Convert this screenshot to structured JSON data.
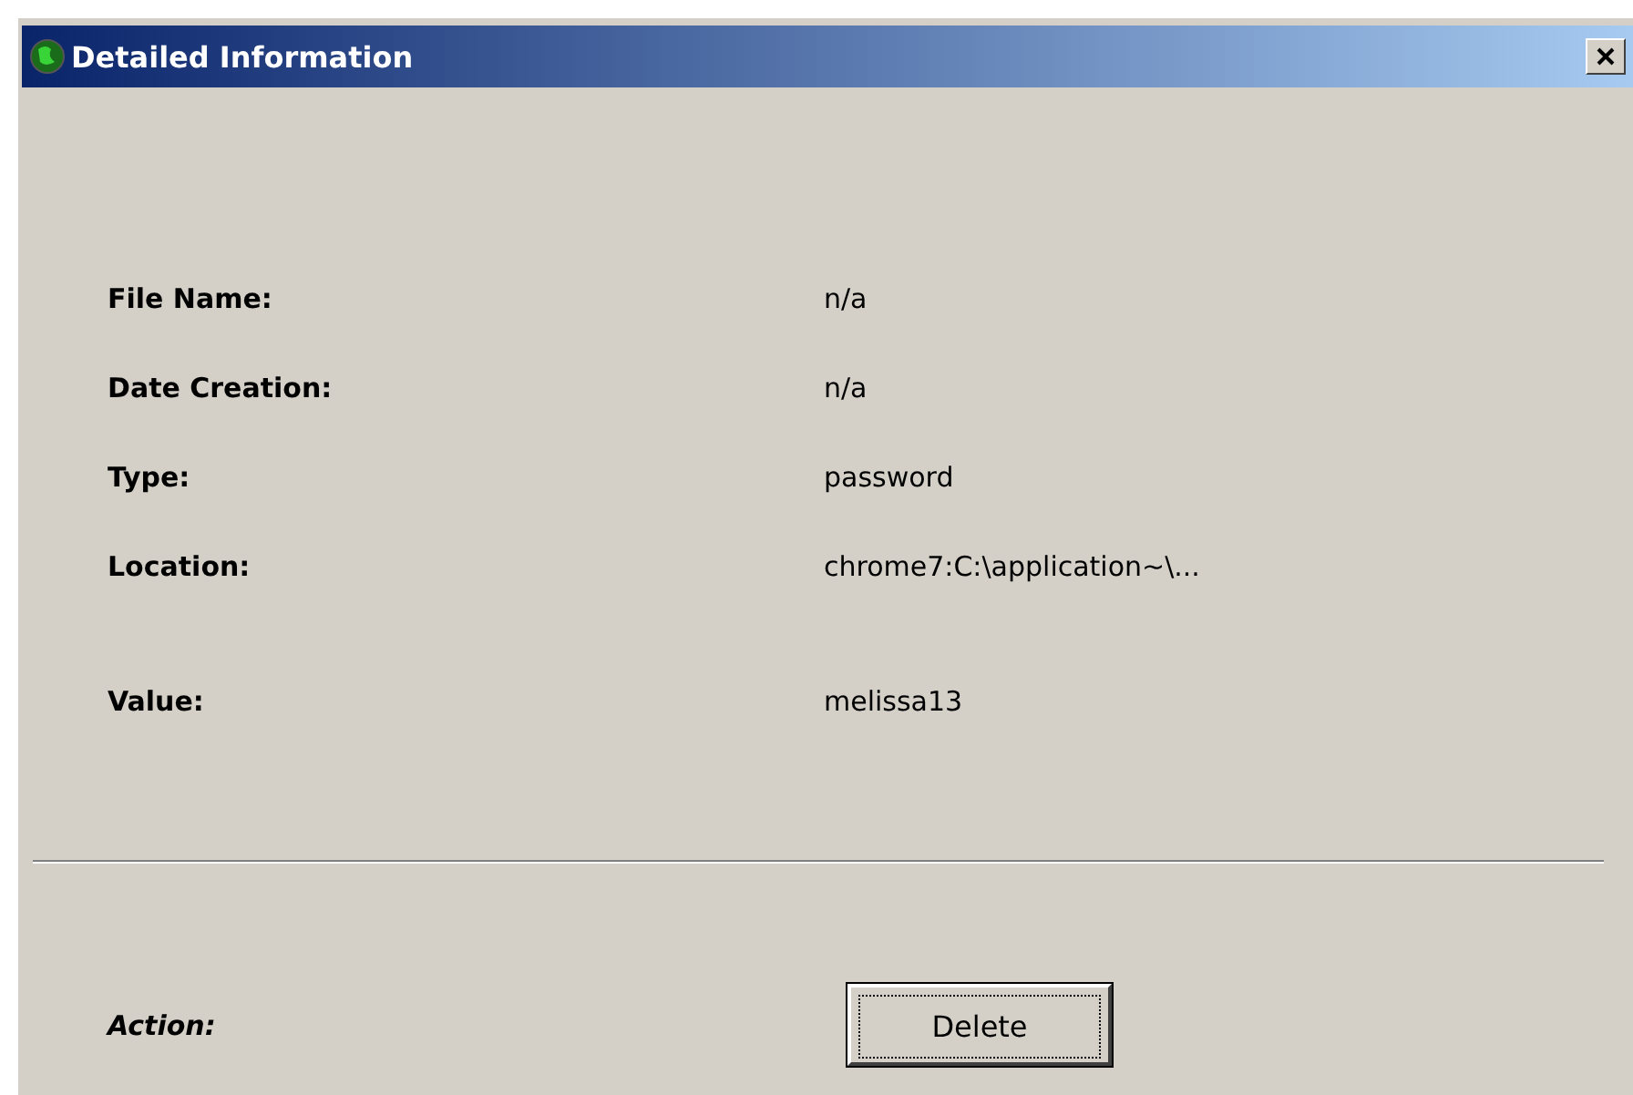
{
  "window": {
    "title": "Detailed Information"
  },
  "fields": [
    {
      "label": "File Name:",
      "value": "n/a"
    },
    {
      "label": "Date Creation:",
      "value": "n/a"
    },
    {
      "label": "Type:",
      "value": "password"
    },
    {
      "label": "Location:",
      "value": "chrome7:C:\\application~\\..."
    }
  ],
  "value_field": {
    "label": "Value:",
    "value": "melissa13"
  },
  "action": {
    "label": "Action:",
    "button": {
      "label": "Delete",
      "focused": true
    }
  }
}
